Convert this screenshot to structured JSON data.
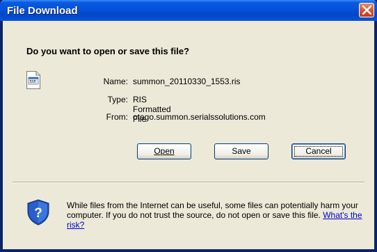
{
  "window": {
    "title": "File Download",
    "close_icon": "close-icon"
  },
  "dialog": {
    "question": "Do you want to open or save this file?",
    "file_icon": "ris-file-icon",
    "fields": [
      {
        "label": "Name:",
        "value": "summon_20110330_1553.ris"
      },
      {
        "label": "Type:",
        "value": "RIS Formatted File"
      },
      {
        "label": "From:",
        "value": "otago.summon.serialssolutions.com"
      }
    ],
    "buttons": {
      "open": "Open",
      "save": "Save",
      "cancel": "Cancel"
    },
    "warning": {
      "icon": "security-shield-icon",
      "text": "While files from the Internet can be useful, some files can potentially harm your computer. If you do not trust the source, do not open or save this file. ",
      "link": "What's the risk?"
    }
  },
  "colors": {
    "titlebar": "#0451d8",
    "dialog_bg": "#ece9d8",
    "close_button": "#d9532e",
    "link": "#0000cc"
  }
}
